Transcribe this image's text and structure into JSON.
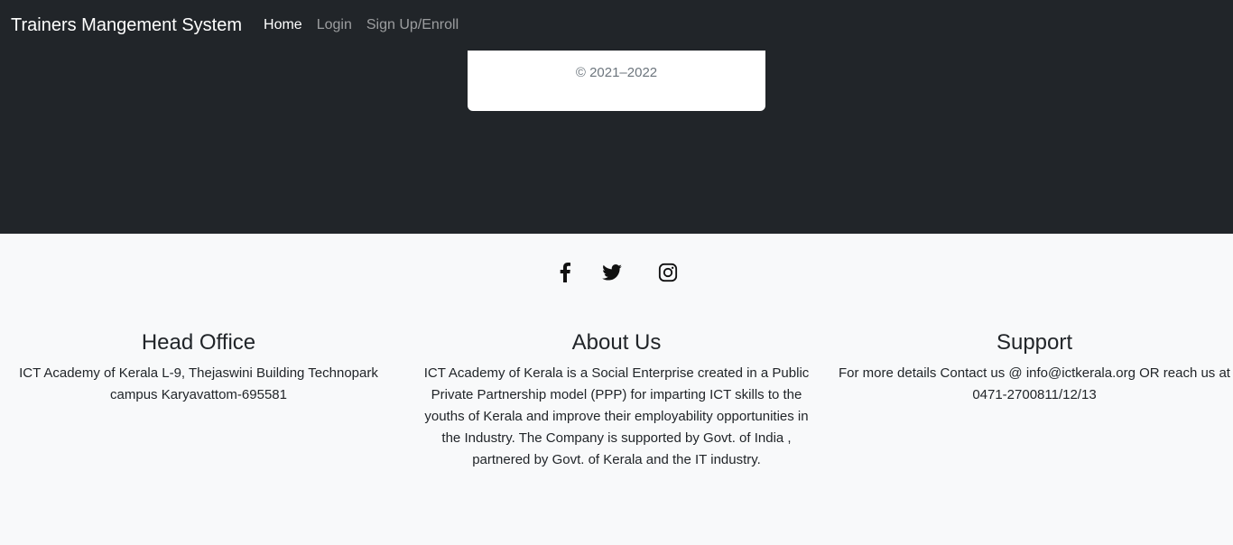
{
  "navbar": {
    "brand": "Trainers Mangement System",
    "links": [
      {
        "label": "Home",
        "active": true
      },
      {
        "label": "Login",
        "active": false
      },
      {
        "label": "Sign Up/Enroll",
        "active": false
      }
    ]
  },
  "card": {
    "copyright": "© 2021–2022"
  },
  "social": [
    "facebook-icon",
    "twitter-icon",
    "instagram-icon"
  ],
  "footer": {
    "head_office": {
      "title": "Head Office",
      "text": "ICT Academy of Kerala L-9, Thejaswini Building Technopark campus Karyavattom-695581"
    },
    "about": {
      "title": "About Us",
      "text": "ICT Academy of Kerala is a Social Enterprise created in a Public Private Partnership model (PPP) for imparting ICT skills to the youths of Kerala and improve their employability opportunities in the Industry. The Company is supported by Govt. of India , partnered by Govt. of Kerala and the IT industry."
    },
    "support": {
      "title": "Support",
      "text": "For more details Contact us @ info@ictkerala.org OR reach us at 0471-2700811/12/13"
    }
  },
  "colors": {
    "dark": "#212529",
    "light": "#f8f9fa"
  }
}
